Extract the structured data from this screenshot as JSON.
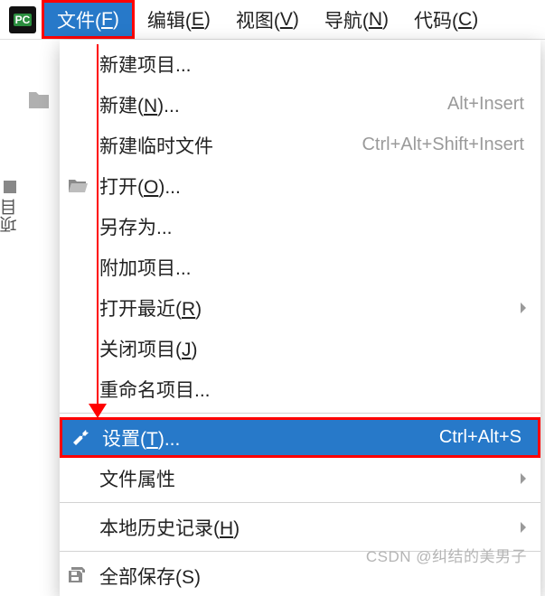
{
  "app_icon_text": "PC",
  "menubar": {
    "file": {
      "label_pre": "文件(",
      "mn": "F",
      "label_post": ")"
    },
    "edit": {
      "label_pre": "编辑(",
      "mn": "E",
      "label_post": ")"
    },
    "view": {
      "label_pre": "视图(",
      "mn": "V",
      "label_post": ")"
    },
    "nav": {
      "label_pre": "导航(",
      "mn": "N",
      "label_post": ")"
    },
    "code": {
      "label_pre": "代码(",
      "mn": "C",
      "label_post": ")"
    }
  },
  "sidebar_tab": "项目",
  "dropdown": {
    "new_project": {
      "label_pre": "新建项目...",
      "mn": "",
      "label_post": ""
    },
    "new": {
      "label_pre": "新建(",
      "mn": "N",
      "label_post": ")...",
      "shortcut": "Alt+Insert"
    },
    "new_scratch": {
      "label_pre": "新建临时文件",
      "mn": "",
      "label_post": "",
      "shortcut": "Ctrl+Alt+Shift+Insert"
    },
    "open": {
      "label_pre": "打开(",
      "mn": "O",
      "label_post": ")..."
    },
    "save_as": {
      "label_pre": "另存为...",
      "mn": "",
      "label_post": ""
    },
    "attach_project": {
      "label_pre": "附加项目...",
      "mn": "",
      "label_post": ""
    },
    "open_recent": {
      "label_pre": "打开最近(",
      "mn": "R",
      "label_post": ")",
      "has_submenu": true
    },
    "close_project": {
      "label_pre": "关闭项目(",
      "mn": "J",
      "label_post": ")"
    },
    "rename_project": {
      "label_pre": "重命名项目...",
      "mn": "",
      "label_post": ""
    },
    "settings": {
      "label_pre": "设置(",
      "mn": "T",
      "label_post": ")...",
      "shortcut": "Ctrl+Alt+S"
    },
    "file_props": {
      "label_pre": "文件属性",
      "mn": "",
      "label_post": "",
      "has_submenu": true
    },
    "local_history": {
      "label_pre": "本地历史记录(",
      "mn": "H",
      "label_post": ")",
      "has_submenu": true
    },
    "save_all": {
      "label_pre": "全部保存(S)",
      "mn": "",
      "label_post": ""
    }
  },
  "watermark": "CSDN @纠结的美男子"
}
